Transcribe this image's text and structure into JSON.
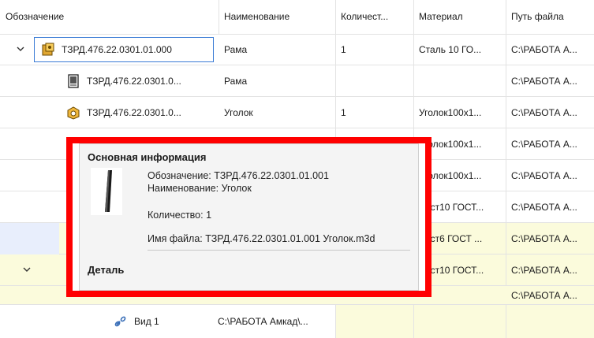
{
  "columns": {
    "designation": "Обозначение",
    "name": "Наименование",
    "quantity": "Количест...",
    "material": "Материал",
    "path": "Путь файла"
  },
  "rows": [
    {
      "designation": "ТЗРД.476.22.0301.01.000",
      "name": "Рама",
      "quantity": "1",
      "material": "Сталь 10  ГО...",
      "path": "С:\\РАБОТА А..."
    },
    {
      "designation": "ТЗРД.476.22.0301.0...",
      "name": "Рама",
      "quantity": "",
      "material": "",
      "path": "С:\\РАБОТА А..."
    },
    {
      "designation": "ТЗРД.476.22.0301.0...",
      "name": "Уголок",
      "quantity": "1",
      "material": "Уголок100х1...",
      "path": "С:\\РАБОТА А..."
    },
    {
      "designation": "",
      "name": "",
      "quantity": "",
      "material": "Уголок100х1...",
      "path": "С:\\РАБОТА А..."
    },
    {
      "designation": "",
      "name": "",
      "quantity": "",
      "material": "Уголок100х1...",
      "path": "С:\\РАБОТА А..."
    },
    {
      "designation": "",
      "name": "",
      "quantity": "",
      "material": "Лист10 ГОСТ...",
      "path": "С:\\РАБОТА А..."
    },
    {
      "designation": "",
      "name": "",
      "quantity": "",
      "material": "Лист6 ГОСТ ...",
      "path": "С:\\РАБОТА А..."
    },
    {
      "designation": "",
      "name": "",
      "quantity": "",
      "material": "Лист10 ГОСТ...",
      "path": "С:\\РАБОТА А..."
    },
    {
      "designation": "",
      "name": "",
      "quantity": "",
      "material": "",
      "path": "С:\\РАБОТА А..."
    },
    {
      "designation": "Вид 1",
      "name": "С:\\РАБОТА Амкад\\...",
      "quantity": "",
      "material": "",
      "path": ""
    }
  ],
  "popup": {
    "title": "Основная информация",
    "designation_line": "Обозначение: ТЗРД.476.22.0301.01.001",
    "name_line": "Наименование: Уголок",
    "quantity_line": "Количество: 1",
    "file_line": "Имя файла: ТЗРД.476.22.0301.01.001 Уголок.m3d",
    "footer": "Деталь"
  },
  "colors": {
    "highlight_border": "#ff0000",
    "selection_border": "#3a7bd5",
    "yellow_row": "#fbfbdc"
  }
}
